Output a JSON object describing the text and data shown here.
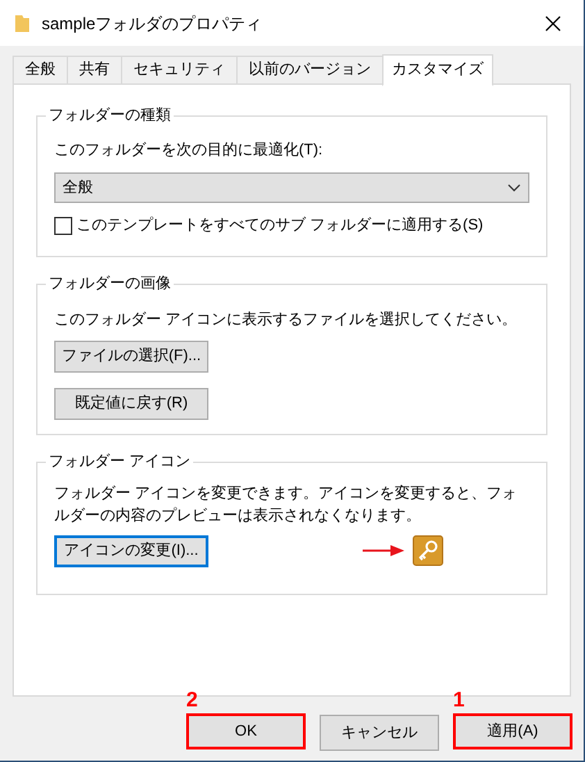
{
  "window": {
    "title": "sampleフォルダのプロパティ"
  },
  "tabs": [
    {
      "label": "全般",
      "selected": false
    },
    {
      "label": "共有",
      "selected": false
    },
    {
      "label": "セキュリティ",
      "selected": false
    },
    {
      "label": "以前のバージョン",
      "selected": false
    },
    {
      "label": "カスタマイズ",
      "selected": true
    }
  ],
  "folder_type": {
    "title": "フォルダーの種類",
    "optimize_label": "このフォルダーを次の目的に最適化(T):",
    "optimize_value": "全般",
    "apply_template": {
      "label": "このテンプレートをすべてのサブ フォルダーに適用する(S)",
      "checked": false
    }
  },
  "folder_picture": {
    "title": "フォルダーの画像",
    "description": "このフォルダー アイコンに表示するファイルを選択してください。",
    "buttons": [
      {
        "label": "ファイルの選択(F)...",
        "focused": false
      },
      {
        "label": "既定値に戻す(R)",
        "focused": false
      }
    ]
  },
  "folder_icon": {
    "title": "フォルダー アイコン",
    "description": "フォルダー アイコンを変更できます。アイコンを変更すると、フォルダーの内容のプレビューは表示されなくなります。",
    "button": {
      "label": "アイコンの変更(I)...",
      "focused": true
    },
    "arrow_pointing": true
  },
  "footer_buttons": [
    {
      "label": "OK",
      "highlighted": true,
      "callout": "2"
    },
    {
      "label": "キャンセル",
      "highlighted": false
    },
    {
      "label": "適用(A)",
      "highlighted": true,
      "callout": "1"
    }
  ]
}
